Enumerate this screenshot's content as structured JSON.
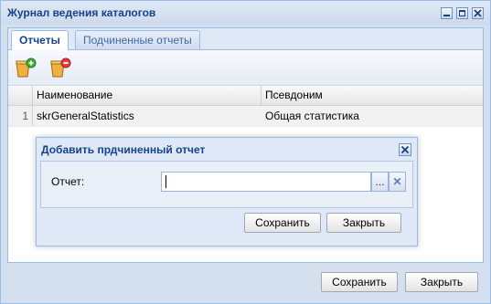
{
  "window": {
    "title": "Журнал ведения каталогов",
    "controls": [
      "minimize-icon",
      "maximize-icon",
      "close-icon"
    ]
  },
  "tabs": [
    {
      "label": "Отчеты",
      "active": true
    },
    {
      "label": "Подчиненные отчеты",
      "active": false
    }
  ],
  "toolbar": {
    "buttons": [
      "add-report-icon",
      "remove-report-icon"
    ]
  },
  "grid": {
    "columns": [
      "Наименование",
      "Псевдоним"
    ],
    "rows": [
      {
        "num": "1",
        "name": "skrGeneralStatistics",
        "alias": "Общая статистика"
      }
    ]
  },
  "dialog": {
    "title": "Добавить прдчиненный отчет",
    "field_label": "Отчет:",
    "field_value": "",
    "lookup_button": "...",
    "clear_button": "✕",
    "save_label": "Сохранить",
    "close_label": "Закрыть"
  },
  "footer": {
    "save_label": "Сохранить",
    "close_label": "Закрыть"
  },
  "colors": {
    "title": "#15428b",
    "border": "#99bbe8",
    "background": "#dfe8f6"
  }
}
